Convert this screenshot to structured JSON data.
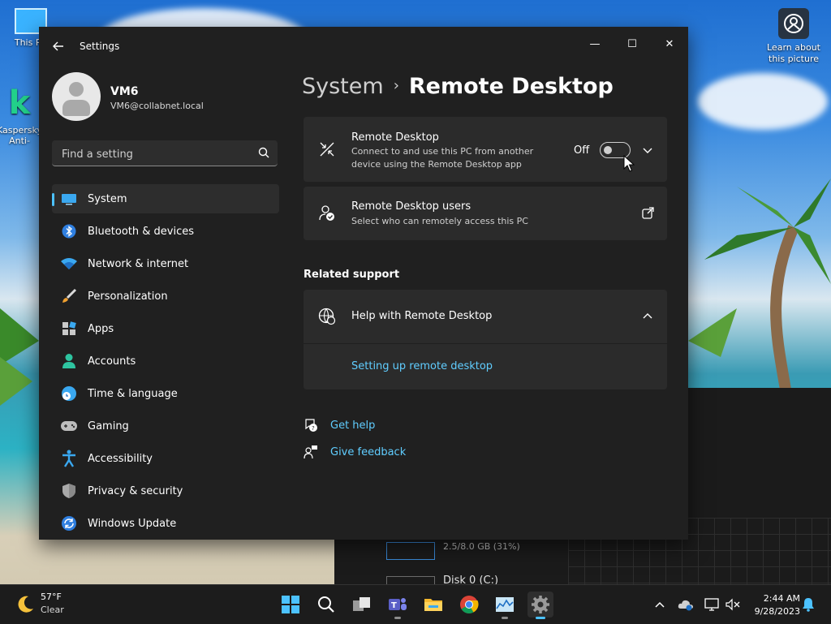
{
  "desktop": {
    "icon_this_pc": "This PC",
    "icon_kaspersky": "Kaspersky Anti-Ransomware",
    "learn_about_picture": "Learn about this picture"
  },
  "taskmgr": {
    "memory_text": "2.5/8.0 GB (31%)",
    "disk_text": "Disk 0 (C:)"
  },
  "window": {
    "title": "Settings",
    "minimize_label": "—",
    "maximize_label": "☐",
    "close_label": "✕"
  },
  "profile": {
    "name": "VM6",
    "email": "VM6@collabnet.local"
  },
  "search": {
    "placeholder": "Find a setting"
  },
  "nav": {
    "items": [
      {
        "label": "System",
        "icon": "monitor-icon",
        "active": true
      },
      {
        "label": "Bluetooth & devices",
        "icon": "bluetooth-icon"
      },
      {
        "label": "Network & internet",
        "icon": "wifi-icon"
      },
      {
        "label": "Personalization",
        "icon": "brush-icon"
      },
      {
        "label": "Apps",
        "icon": "apps-icon"
      },
      {
        "label": "Accounts",
        "icon": "person-icon"
      },
      {
        "label": "Time & language",
        "icon": "globe-clock-icon"
      },
      {
        "label": "Gaming",
        "icon": "gamepad-icon"
      },
      {
        "label": "Accessibility",
        "icon": "accessibility-icon"
      },
      {
        "label": "Privacy & security",
        "icon": "shield-icon"
      },
      {
        "label": "Windows Update",
        "icon": "update-icon"
      }
    ]
  },
  "breadcrumb": {
    "parent": "System",
    "separator": "›",
    "current": "Remote Desktop"
  },
  "remote_desktop_card": {
    "title": "Remote Desktop",
    "description": "Connect to and use this PC from another device using the Remote Desktop app",
    "toggle_state": "Off"
  },
  "remote_users_card": {
    "title": "Remote Desktop users",
    "description": "Select who can remotely access this PC"
  },
  "related_support": {
    "heading": "Related support",
    "help_title": "Help with Remote Desktop",
    "help_link": "Setting up remote desktop"
  },
  "footer_links": {
    "get_help": "Get help",
    "give_feedback": "Give feedback"
  },
  "taskbar": {
    "weather_temp": "57°F",
    "weather_condition": "Clear",
    "time": "2:44 AM",
    "date": "9/28/2023"
  },
  "colors": {
    "accent": "#4cc2ff",
    "link": "#60cdff",
    "window_bg": "#202020",
    "card_bg": "#2b2b2b"
  }
}
